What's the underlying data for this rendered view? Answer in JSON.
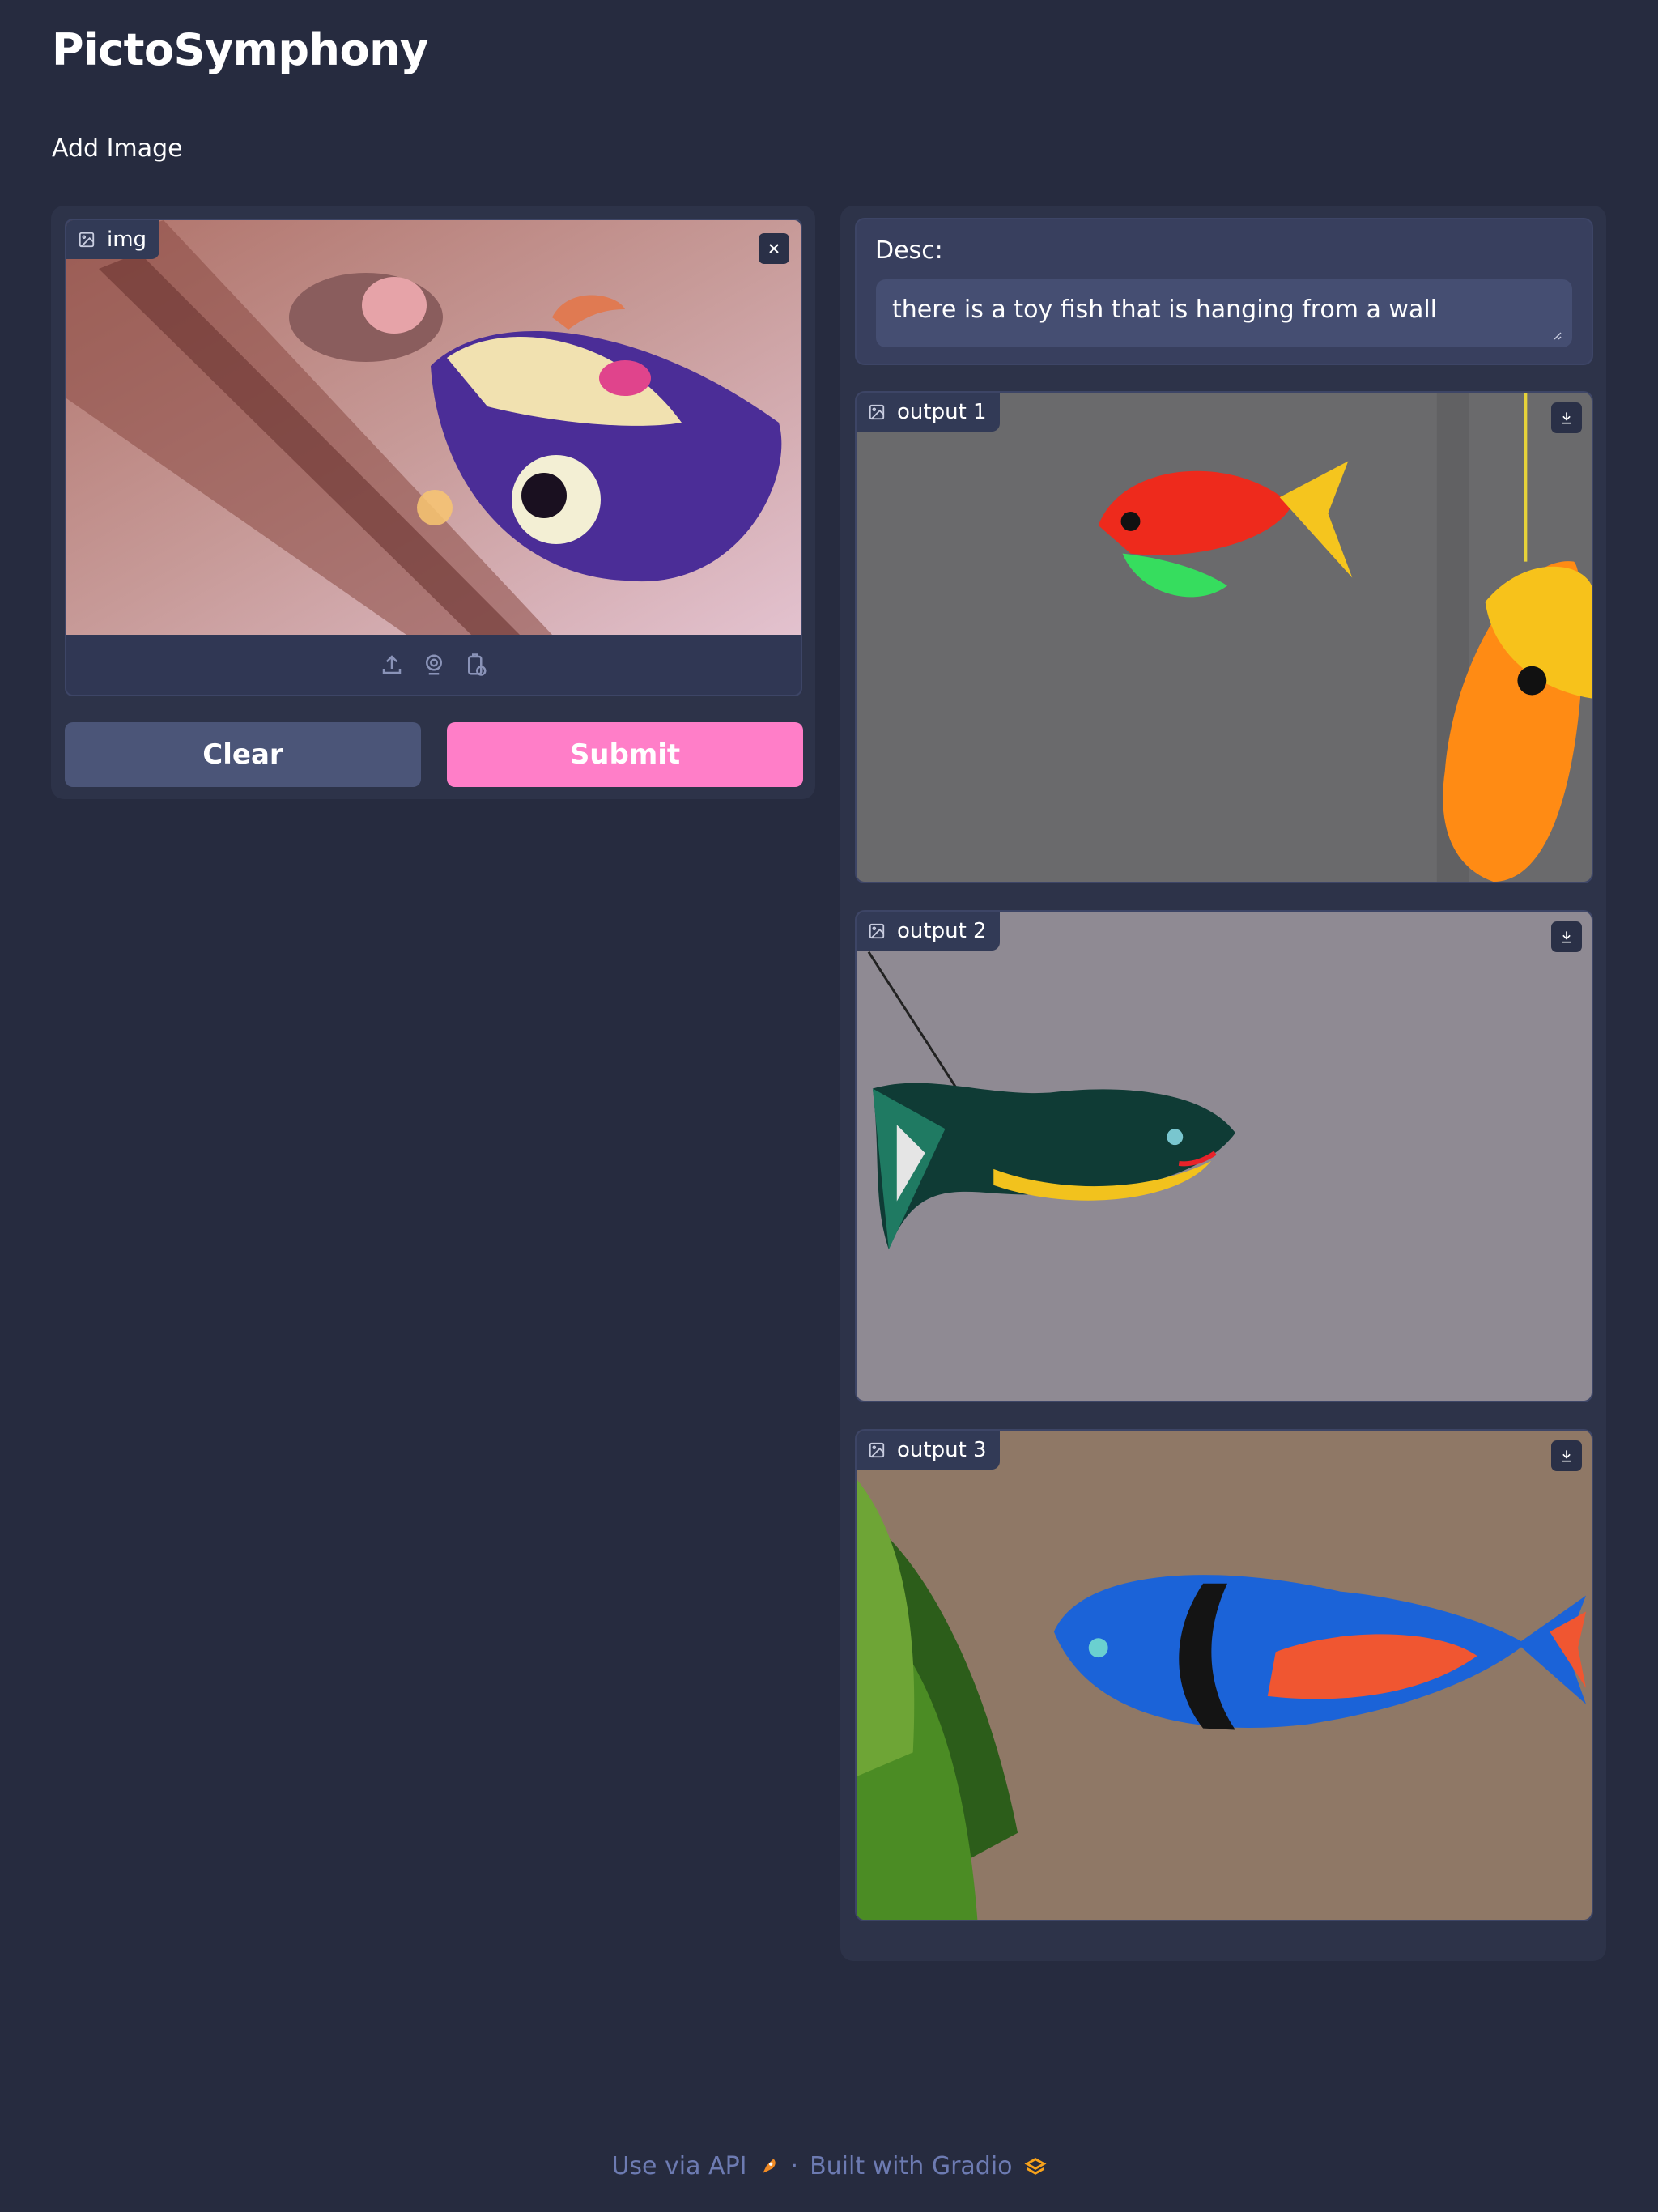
{
  "app": {
    "title": "PictoSymphony",
    "subtitle": "Add Image"
  },
  "input_image": {
    "label": "img"
  },
  "buttons": {
    "clear": "Clear",
    "submit": "Submit"
  },
  "description": {
    "label": "Desc:",
    "value": "there is a toy fish that is hanging from a wall"
  },
  "outputs": [
    {
      "label": "output 1"
    },
    {
      "label": "output 2"
    },
    {
      "label": "output 3"
    }
  ],
  "footer": {
    "api_link": "Use via API",
    "separator": "·",
    "built_with": "Built with Gradio"
  },
  "colors": {
    "background": "#262b3f",
    "panel": "#2d3349",
    "submit": "#ff7ec8",
    "clear": "#4b5578",
    "footer_text": "#6d7bb2"
  },
  "icons": [
    "image-icon",
    "close-icon",
    "upload-icon",
    "webcam-icon",
    "clipboard-icon",
    "download-icon",
    "rocket-icon",
    "gradio-logo-icon"
  ]
}
